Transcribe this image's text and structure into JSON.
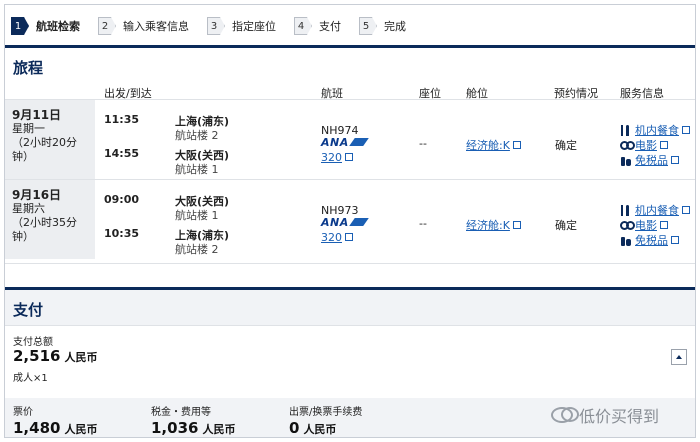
{
  "steps": [
    {
      "num": "1",
      "label": "航班检索"
    },
    {
      "num": "2",
      "label": "输入乘客信息"
    },
    {
      "num": "3",
      "label": "指定座位"
    },
    {
      "num": "4",
      "label": "支付"
    },
    {
      "num": "5",
      "label": "完成"
    }
  ],
  "itinerary": {
    "title": "旅程",
    "headers": {
      "depart_arrive": "出发/到达",
      "flight": "航班",
      "seat": "座位",
      "cabin": "舱位",
      "status": "预约情况",
      "service": "服务信息"
    },
    "segments": [
      {
        "date": "9月11日",
        "weekday": "星期一",
        "duration_line1": "（2小时20分",
        "duration_line2": "钟）",
        "dep_time": "11:35",
        "dep_city": "上海(浦东)",
        "dep_terminal": "航站楼 2",
        "arr_time": "14:55",
        "arr_city": "大阪(关西)",
        "arr_terminal": "航站楼 1",
        "flight_no": "NH974",
        "airline": "ANA",
        "aircraft": "320",
        "seat": "--",
        "cabin": "经济舱:K",
        "status": "确定",
        "services": [
          "机内餐食",
          "电影",
          "免税品"
        ]
      },
      {
        "date": "9月16日",
        "weekday": "星期六",
        "duration_line1": "（2小时35分",
        "duration_line2": "钟）",
        "dep_time": "09:00",
        "dep_city": "大阪(关西)",
        "dep_terminal": "航站楼 1",
        "arr_time": "10:35",
        "arr_city": "上海(浦东)",
        "arr_terminal": "航站楼 2",
        "flight_no": "NH973",
        "airline": "ANA",
        "aircraft": "320",
        "seat": "--",
        "cabin": "经济舱:K",
        "status": "确定",
        "services": [
          "机内餐食",
          "电影",
          "免税品"
        ]
      }
    ]
  },
  "payment": {
    "title": "支付",
    "total_label": "支付总额",
    "total_amount": "2,516",
    "currency": "人民币",
    "passengers": "成人×1",
    "fare_label": "票价",
    "fare_amount": "1,480",
    "tax_label": "税金・费用等",
    "tax_amount": "1,036",
    "fee_label": "出票/换票手续费",
    "fee_amount": "0"
  },
  "watermark": "低价买得到",
  "colors": {
    "navy": "#0b2a5a",
    "link": "#1a5fb4"
  }
}
